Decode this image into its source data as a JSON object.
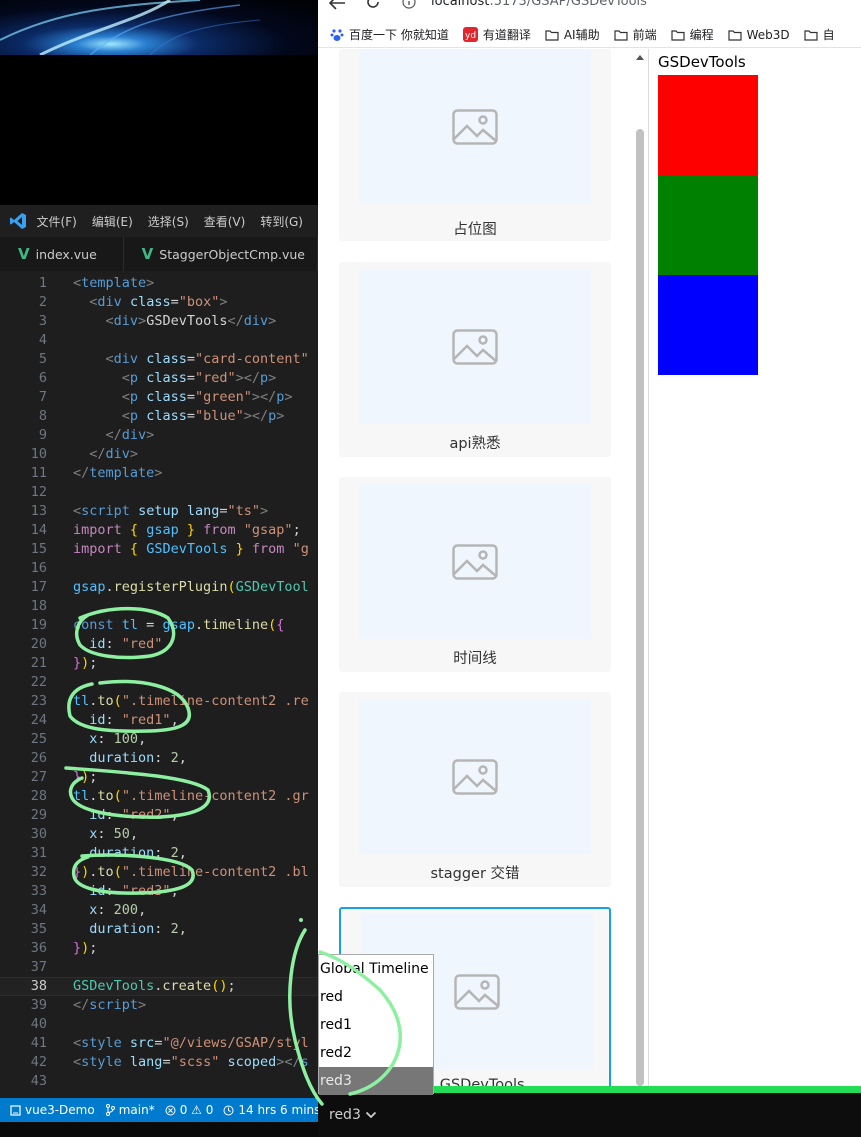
{
  "browser": {
    "url_host": "localhost",
    "url_path": ":5173/GSAP/GSDevTools",
    "bookmarks": [
      "百度一下 你就知道",
      "有道翻译",
      "AI辅助",
      "前端",
      "编程",
      "Web3D",
      "自"
    ]
  },
  "vscode": {
    "menu": [
      "文件(F)",
      "编辑(E)",
      "选择(S)",
      "查看(V)",
      "转到(G)"
    ],
    "tabs": [
      "index.vue",
      "StaggerObjectCmp.vue"
    ],
    "current_line": 38,
    "status": {
      "project": "vue3-Demo",
      "branch": "main*",
      "problems": "0 ⚠ 0",
      "time": "14 hrs 6 mins"
    }
  },
  "cards": [
    {
      "label": "占位图"
    },
    {
      "label": "api熟悉"
    },
    {
      "label": "时间线"
    },
    {
      "label": "stagger 交错"
    },
    {
      "label": ") GSDevTools"
    }
  ],
  "demo": {
    "title": "GSDevTools",
    "box_colors": [
      "#ff0000",
      "#008000",
      "#0000ff"
    ]
  },
  "gsdevtools": {
    "selected": "red3",
    "options": [
      "Global Timeline",
      "red",
      "red1",
      "red2",
      "red3"
    ],
    "progress_color": "#22dd55"
  }
}
